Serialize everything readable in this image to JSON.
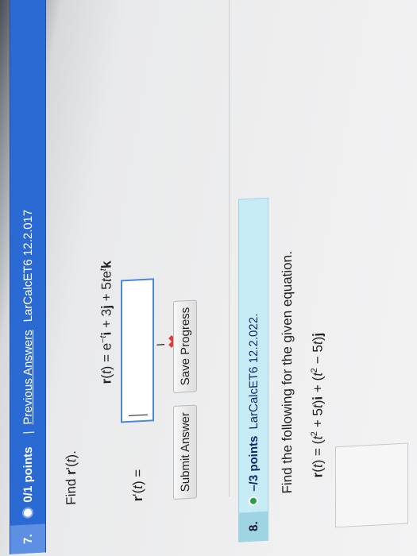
{
  "question7": {
    "number": "7.",
    "points": "0/1 points",
    "separator": "|",
    "previous_answers": "Previous Answers",
    "source": "LarCalcET6 12.2.017",
    "instruction": "Find r'(t).",
    "equation": "r(t) = e−ti + 3j + 5tetk",
    "answer_label": "r'(t) =",
    "answer_value": "",
    "status": "incorrect",
    "submit_label": "Submit Answer",
    "save_label": "Save Progress"
  },
  "question8": {
    "number": "8.",
    "points": "–/3 points",
    "source": "LarCalcET6 12.2.022.",
    "instruction": "Find the following for the given equation.",
    "equation": "r(t) = (t2 + 5t)i + (t2 − 5t)j"
  },
  "colors": {
    "header7": "#2b6ad3",
    "header8": "#c7ecf5",
    "input_border": "#4a86d9",
    "incorrect": "#e03c3c",
    "status_dot8": "#2a9d4a"
  },
  "icons": {
    "incorrect": "x-mark-icon",
    "cursor": "i-beam-cursor-icon",
    "status7": "points-dot-icon",
    "status8": "plus-dot-icon"
  }
}
